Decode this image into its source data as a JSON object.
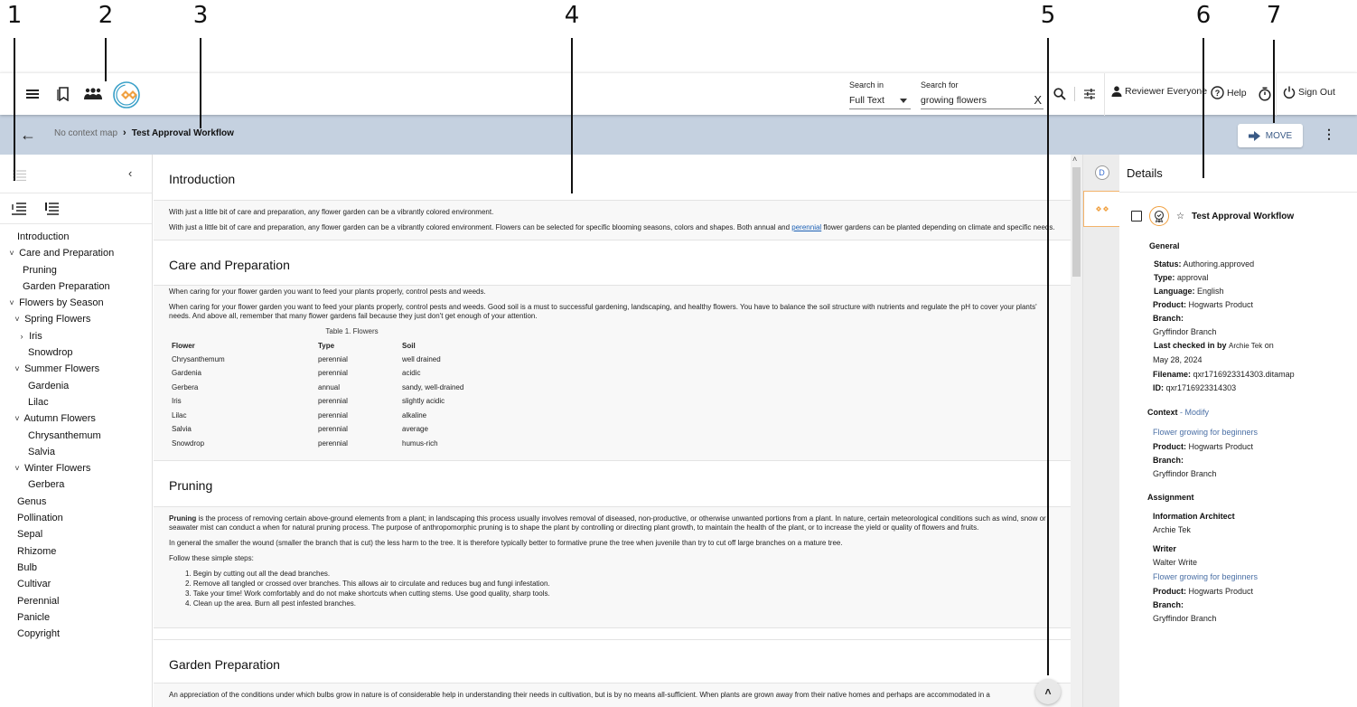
{
  "callouts": [
    "1",
    "2",
    "3",
    "4",
    "5",
    "6",
    "7"
  ],
  "topbar": {
    "search_in_label": "Search in",
    "search_in_value": "Full Text",
    "search_for_label": "Search for",
    "search_for_value": "growing flowers",
    "clear_label": "X",
    "user_label": "Reviewer Everyone",
    "help_label": "Help",
    "signout_label": "Sign Out"
  },
  "breadcrumb": {
    "parent": "No context map",
    "current": "Test Approval Workflow"
  },
  "toolbar": {
    "move_label": "MOVE"
  },
  "toc": {
    "items": [
      {
        "label": "Introduction",
        "indent": 0,
        "toggle": ""
      },
      {
        "label": "Care and Preparation",
        "indent": 0,
        "toggle": "v"
      },
      {
        "label": "Pruning",
        "indent": 1,
        "toggle": ""
      },
      {
        "label": "Garden Preparation",
        "indent": 1,
        "toggle": ""
      },
      {
        "label": "Flowers by Season",
        "indent": 0,
        "toggle": "v"
      },
      {
        "label": "Spring Flowers",
        "indent": 1,
        "toggle": "v"
      },
      {
        "label": "Iris",
        "indent": 2,
        "toggle": ">"
      },
      {
        "label": "Snowdrop",
        "indent": 2,
        "toggle": ""
      },
      {
        "label": "Summer Flowers",
        "indent": 1,
        "toggle": "v"
      },
      {
        "label": "Gardenia",
        "indent": 2,
        "toggle": ""
      },
      {
        "label": "Lilac",
        "indent": 2,
        "toggle": ""
      },
      {
        "label": "Autumn Flowers",
        "indent": 1,
        "toggle": "v"
      },
      {
        "label": "Chrysanthemum",
        "indent": 2,
        "toggle": ""
      },
      {
        "label": "Salvia",
        "indent": 2,
        "toggle": ""
      },
      {
        "label": "Winter Flowers",
        "indent": 1,
        "toggle": "v"
      },
      {
        "label": "Gerbera",
        "indent": 2,
        "toggle": ""
      },
      {
        "label": "Genus",
        "indent": 0,
        "toggle": ""
      },
      {
        "label": "Pollination",
        "indent": 0,
        "toggle": ""
      },
      {
        "label": "Sepal",
        "indent": 0,
        "toggle": ""
      },
      {
        "label": "Rhizome",
        "indent": 0,
        "toggle": ""
      },
      {
        "label": "Bulb",
        "indent": 0,
        "toggle": ""
      },
      {
        "label": "Cultivar",
        "indent": 0,
        "toggle": ""
      },
      {
        "label": "Perennial",
        "indent": 0,
        "toggle": ""
      },
      {
        "label": "Panicle",
        "indent": 0,
        "toggle": ""
      },
      {
        "label": "Copyright",
        "indent": 0,
        "toggle": ""
      }
    ]
  },
  "content": {
    "intro": {
      "title": "Introduction",
      "short": "With just a little bit of care and preparation, any flower garden can be a vibrantly colored environment.",
      "long_pre": "With just a little bit of care and preparation, any flower garden can be a vibrantly colored environment. Flowers can be selected for specific blooming seasons, colors and shapes. Both annual and ",
      "long_link": "perennial",
      "long_post": " flower gardens can be planted depending on climate and specific needs."
    },
    "care": {
      "title": "Care and Preparation",
      "short": "When caring for your flower garden you want to feed your plants properly, control pests and weeds.",
      "long": "When caring for your flower garden you want to feed your plants properly, control pests and weeds. Good soil is a must to successful gardening, landscaping, and healthy flowers. You have to balance the soil structure with nutrients and regulate the pH to cover your plants' needs. And above all, remember that many flower gardens fail because they just don't get enough of your attention.",
      "table": {
        "caption": "Table 1. Flowers",
        "headers": [
          "Flower",
          "Type",
          "Soil"
        ],
        "rows": [
          [
            "Chrysanthemum",
            "perennial",
            "well drained"
          ],
          [
            "Gardenia",
            "perennial",
            "acidic"
          ],
          [
            "Gerbera",
            "annual",
            "sandy, well-drained"
          ],
          [
            "Iris",
            "perennial",
            "slightly acidic"
          ],
          [
            "Lilac",
            "perennial",
            "alkaline"
          ],
          [
            "Salvia",
            "perennial",
            "average"
          ],
          [
            "Snowdrop",
            "perennial",
            "humus-rich"
          ]
        ]
      }
    },
    "pruning": {
      "title": "Pruning",
      "term": "Pruning",
      "p1": " is the process of removing certain above-ground elements from a plant; in landscaping this process usually involves removal of diseased, non-productive, or otherwise unwanted portions from a plant. In nature, certain meteorological conditions such as wind, snow or seawater mist can conduct a when for natural pruning process. The purpose of anthropomorphic pruning is to shape the plant by controlling or directing plant growth, to maintain the health of the plant, or to increase the yield or quality of flowers and fruits.",
      "p2": "In general the smaller the wound (smaller the branch that is cut) the less harm to the tree. It is therefore typically better to formative prune the tree when juvenile than try to cut off large branches on a mature tree.",
      "p3": "Follow these simple steps:",
      "steps": [
        "1. Begin by cutting out all the dead branches.",
        "2. Remove all tangled or crossed over branches. This allows air to circulate and reduces bug and fungi infestation.",
        "3. Take your time! Work comfortably and do not make shortcuts when cutting stems. Use good quality, sharp tools.",
        "4. Clean up the area. Burn all pest infested branches."
      ]
    },
    "garden": {
      "title": "Garden Preparation",
      "p1": "An appreciation of the conditions under which bulbs grow in nature is of considerable help in understanding their needs in cultivation, but is by no means all-sufficient. When plants are grown away from their native homes and perhaps are accommodated in a"
    }
  },
  "rail": {
    "d_label": "D"
  },
  "details": {
    "title": "Details",
    "item_name": "Test Approval Workflow",
    "general_label": "General",
    "status_key": "Status:",
    "status_val": "Authoring.approved",
    "type_key": "Type:",
    "type_val": "approval",
    "language_key": "Language:",
    "language_val": "English",
    "product_key": "Product:",
    "product_val": "Hogwarts Product",
    "branch_key": "Branch:",
    "branch_val": "Gryffindor Branch",
    "checked_key": "Last checked in by",
    "checked_user": "Archie Tek",
    "checked_on": "on",
    "checked_date": "May 28, 2024",
    "filename_key": "Filename:",
    "filename_val": "qxr1716923314303.ditamap",
    "id_key": "ID:",
    "id_val": "qxr1716923314303",
    "context_label": "Context",
    "context_modify": "- Modify",
    "context_map": "Flower growing for beginners",
    "context_product_key": "Product:",
    "context_product_val": "Hogwarts Product",
    "context_branch_key": "Branch:",
    "context_branch_val": "Gryffindor Branch",
    "assignment_label": "Assignment",
    "ia_role": "Information Architect",
    "ia_name": "Archie Tek",
    "writer_role": "Writer",
    "writer_name": "Walter Write",
    "writer_map": "Flower growing for beginners",
    "writer_product_key": "Product:",
    "writer_product_val": "Hogwarts Product",
    "writer_branch_key": "Branch:",
    "writer_branch_val": "Gryffindor Branch"
  },
  "colors": {
    "accent": "#f0a040",
    "breadcrumb_bg": "#c5d1e0",
    "link": "#1a5fb4",
    "move_text": "#3a5a86"
  }
}
